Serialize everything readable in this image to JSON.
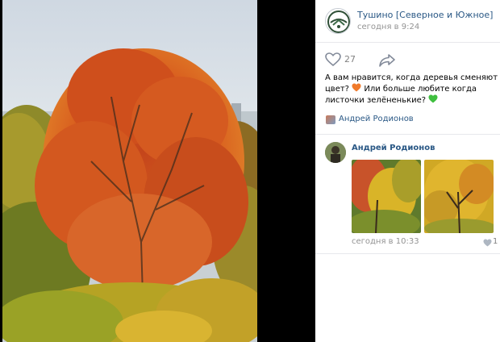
{
  "post": {
    "group_name": "Тушино [Северное и Южное]",
    "time": "сегодня в 9:24",
    "likes": "27",
    "text_parts": [
      "А вам нравится, когда деревья сменяют цвет?",
      "Или больше любите когда листочки зелёненькие?"
    ],
    "author": "Андрей Родионов"
  },
  "comment": {
    "author": "Андрей Родионов",
    "time": "сегодня в 10:33",
    "likes": "1"
  },
  "colors": {
    "link": "#2a5885",
    "muted": "#939393",
    "orange_heart": "#f07a2b",
    "green_heart": "#3fbf3f"
  },
  "icons": [
    "heart-outline-icon",
    "share-arrow-icon",
    "orange-heart-emoji",
    "green-heart-emoji",
    "author-avatar-icon",
    "comment-like-heart-icon"
  ]
}
